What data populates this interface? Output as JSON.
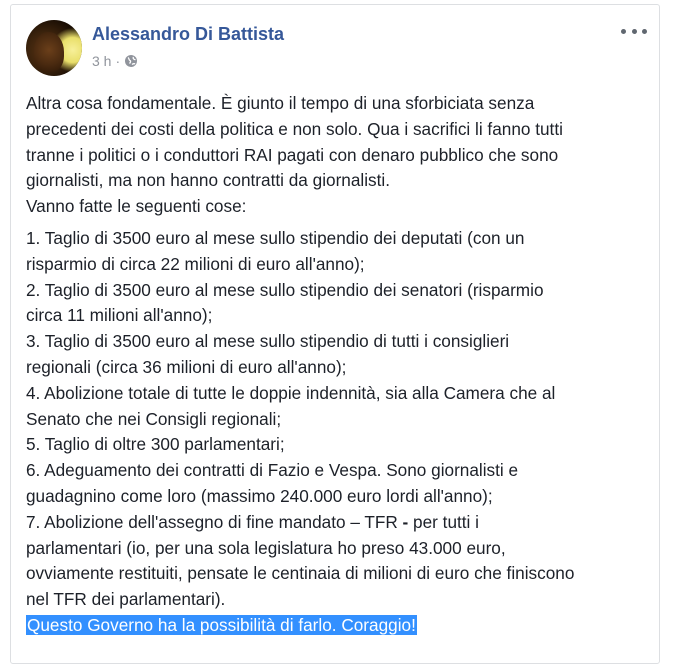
{
  "post": {
    "author": "Alessandro Di Battista",
    "time": "3 h",
    "separator": "·",
    "privacy_icon": "globe-icon",
    "more_icon": "more-options-icon",
    "intro_lines": [
      "Altra cosa fondamentale. È giunto il tempo di una sforbiciata senza",
      "precedenti dei costi della politica e non solo. Qua i sacrifici li fanno tutti",
      "tranne i politici o i conduttori RAI pagati con denaro pubblico che sono",
      "giornalisti, ma non hanno contratti da giornalisti.",
      "Vanno fatte le seguenti cose:"
    ],
    "list_lines": [
      "1. Taglio di 3500 euro al mese sullo stipendio dei deputati (con un",
      "risparmio di circa 22 milioni di euro all'anno);",
      "2. Taglio di 3500 euro al mese sullo stipendio dei senatori (risparmio",
      "circa 11 milioni all'anno);",
      "3. Taglio di 3500 euro al mese sullo stipendio di tutti i consiglieri",
      "regionali (circa 36 milioni di euro all'anno);",
      "4. Abolizione totale di tutte le doppie indennità, sia alla Camera che al",
      "Senato che nei Consigli regionali;",
      "5. Taglio di oltre 300 parlamentari;",
      "6. Adeguamento dei contratti di Fazio e Vespa. Sono giornalisti e",
      "guadagnino come loro (massimo 240.000 euro lordi all'anno);"
    ],
    "tfr_line_before": "7. Abolizione dell'assegno di fine mandato – TFR ",
    "tfr_line_bold": "-",
    "tfr_line_after": " per tutti i",
    "list_tail_lines": [
      "parlamentari (io, per una sola legislatura ho preso 43.000 euro,",
      "ovviamente restituiti, pensate le centinaia di milioni di euro che finiscono",
      "nel TFR dei parlamentari)."
    ],
    "closing_highlighted": "Questo Governo ha la possibilità di farlo. Coraggio!"
  },
  "colors": {
    "author_link": "#365899",
    "meta_gray": "#90949c",
    "body_text": "#1d2129",
    "selection": "#3390ff"
  }
}
